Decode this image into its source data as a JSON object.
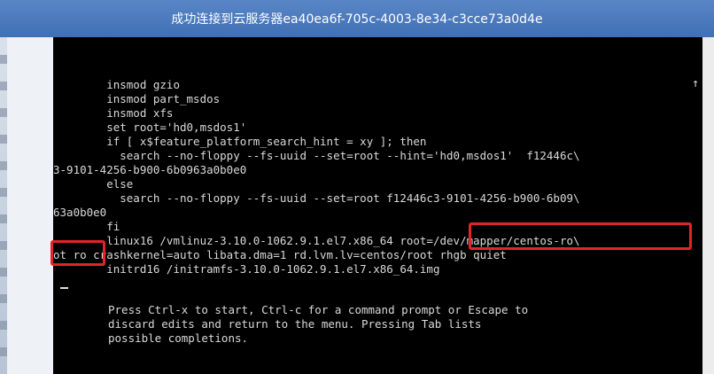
{
  "window": {
    "title": "成功连接到云服务器ea40ea6f-705c-4003-8e34-c3cce73a0d4e"
  },
  "terminal": {
    "scroll_indicator": "↑",
    "lines": [
      "        insmod gzio",
      "        insmod part_msdos",
      "        insmod xfs",
      "        set root='hd0,msdos1'",
      "        if [ x$feature_platform_search_hint = xy ]; then",
      "          search --no-floppy --fs-uuid --set=root --hint='hd0,msdos1'  f12446c\\",
      "3-9101-4256-b900-6b0963a0b0e0",
      "        else",
      "          search --no-floppy --fs-uuid --set=root f12446c3-9101-4256-b900-6b09\\",
      "63a0b0e0",
      "        fi",
      "        linux16 /vmlinuz-3.10.0-1062.9.1.el7.x86_64 root=/dev/mapper/centos-ro\\",
      "ot ro crashkernel=auto libata.dma=1 rd.lvm.lv=centos/root rhgb quiet",
      "        initrd16 /initramfs-3.10.0-1062.9.1.el7.x86_64.img"
    ],
    "help_lines": [
      "Press Ctrl-x to start, Ctrl-c for a command prompt or Escape to",
      "discard edits and return to the menu. Pressing Tab lists",
      "possible completions."
    ]
  },
  "highlight_color": "#e4232a"
}
